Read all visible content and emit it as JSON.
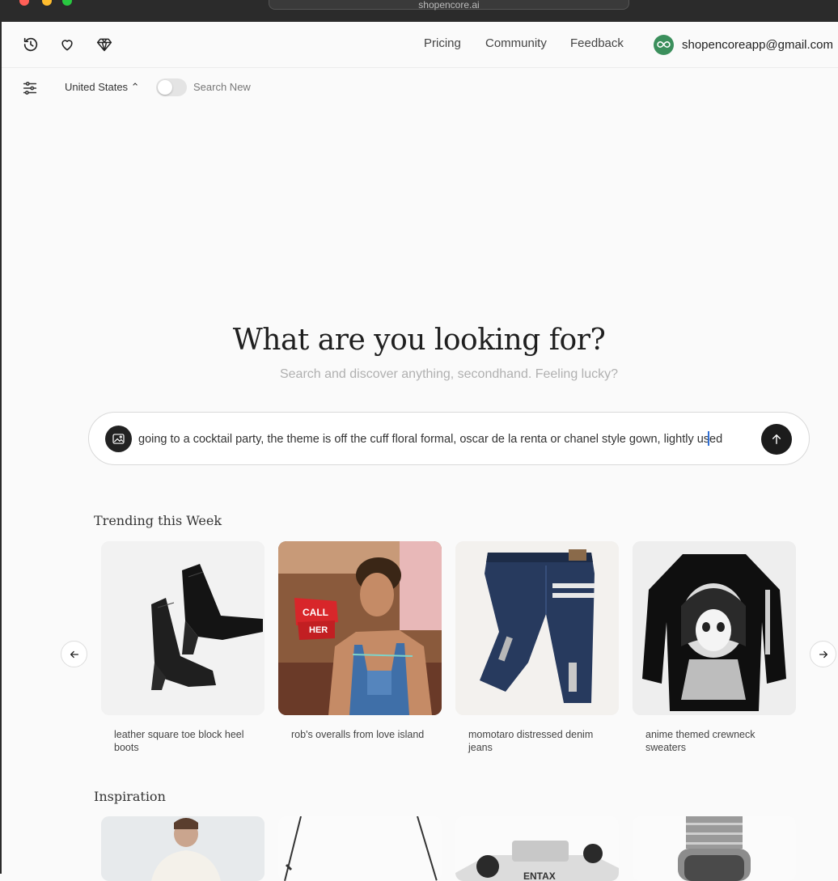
{
  "browser": {
    "url": "shopencore.ai"
  },
  "nav": {
    "links": [
      "Pricing",
      "Community",
      "Feedback"
    ],
    "email": "shopencoreapp@gmail.com"
  },
  "filters": {
    "country": "United States ⌃",
    "toggle_label": "Search New"
  },
  "hero": {
    "title": "What are you looking for?",
    "subtitle": "Search and discover anything, secondhand. Feeling lucky?"
  },
  "search": {
    "value": "going to a cocktail party, the theme is off the cuff floral formal, oscar de la renta or chanel style gown, lightly used"
  },
  "trending": {
    "title": "Trending this Week",
    "items": [
      {
        "caption": "leather square toe block heel boots"
      },
      {
        "caption": "rob's overalls from love island"
      },
      {
        "caption": "momotaro distressed denim jeans"
      },
      {
        "caption": "anime themed crewneck sweaters"
      }
    ]
  },
  "inspiration": {
    "title": "Inspiration"
  },
  "colors": {
    "accent": "#3b8f5c",
    "dark_button": "#1c1c1c"
  }
}
